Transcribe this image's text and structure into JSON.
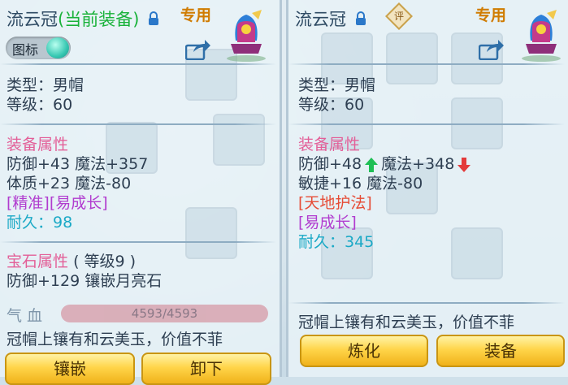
{
  "left": {
    "title": "流云冠",
    "title_current": "(当前装备)",
    "special_label": "专用",
    "toggle_label": "图标",
    "type_line": "类型：男帽",
    "level_line": "等级：60",
    "equip_attr_head": "装备属性",
    "attr_line1": "防御+43 魔法+357",
    "attr_line2": "体质+23 魔法-80",
    "tags": "[精准][易成长]",
    "durability": "耐久：98",
    "gem_head": "宝石属性",
    "gem_level": "( 等级9 )",
    "gem_line": "防御+129 镶嵌月亮石",
    "hp_label": "气 血",
    "hp_value": "4593/4593",
    "description": "冠帽上镶有和云美玉，价值不菲",
    "btn_inlay": "镶嵌",
    "btn_unequip": "卸下"
  },
  "right": {
    "title": "流云冠",
    "eval_label": "评",
    "special_label": "专用",
    "type_line": "类型：男帽",
    "level_line": "等级：60",
    "equip_attr_head": "装备属性",
    "attr_line1a": "防御+48",
    "attr_line1b": "魔法+348",
    "attr_line2": "敏捷+16 魔法-80",
    "tag_red": "[天地护法]",
    "tag_purple": "[易成长]",
    "durability": "耐久：345",
    "description": "冠帽上镶有和云美玉，价值不菲",
    "btn_refine": "炼化",
    "btn_equip": "装备"
  },
  "icons": [
    "lock-icon",
    "hat-icon",
    "share-icon",
    "toggle-knob-icon",
    "arrow-up-icon",
    "arrow-down-icon",
    "eval-badge-icon"
  ]
}
